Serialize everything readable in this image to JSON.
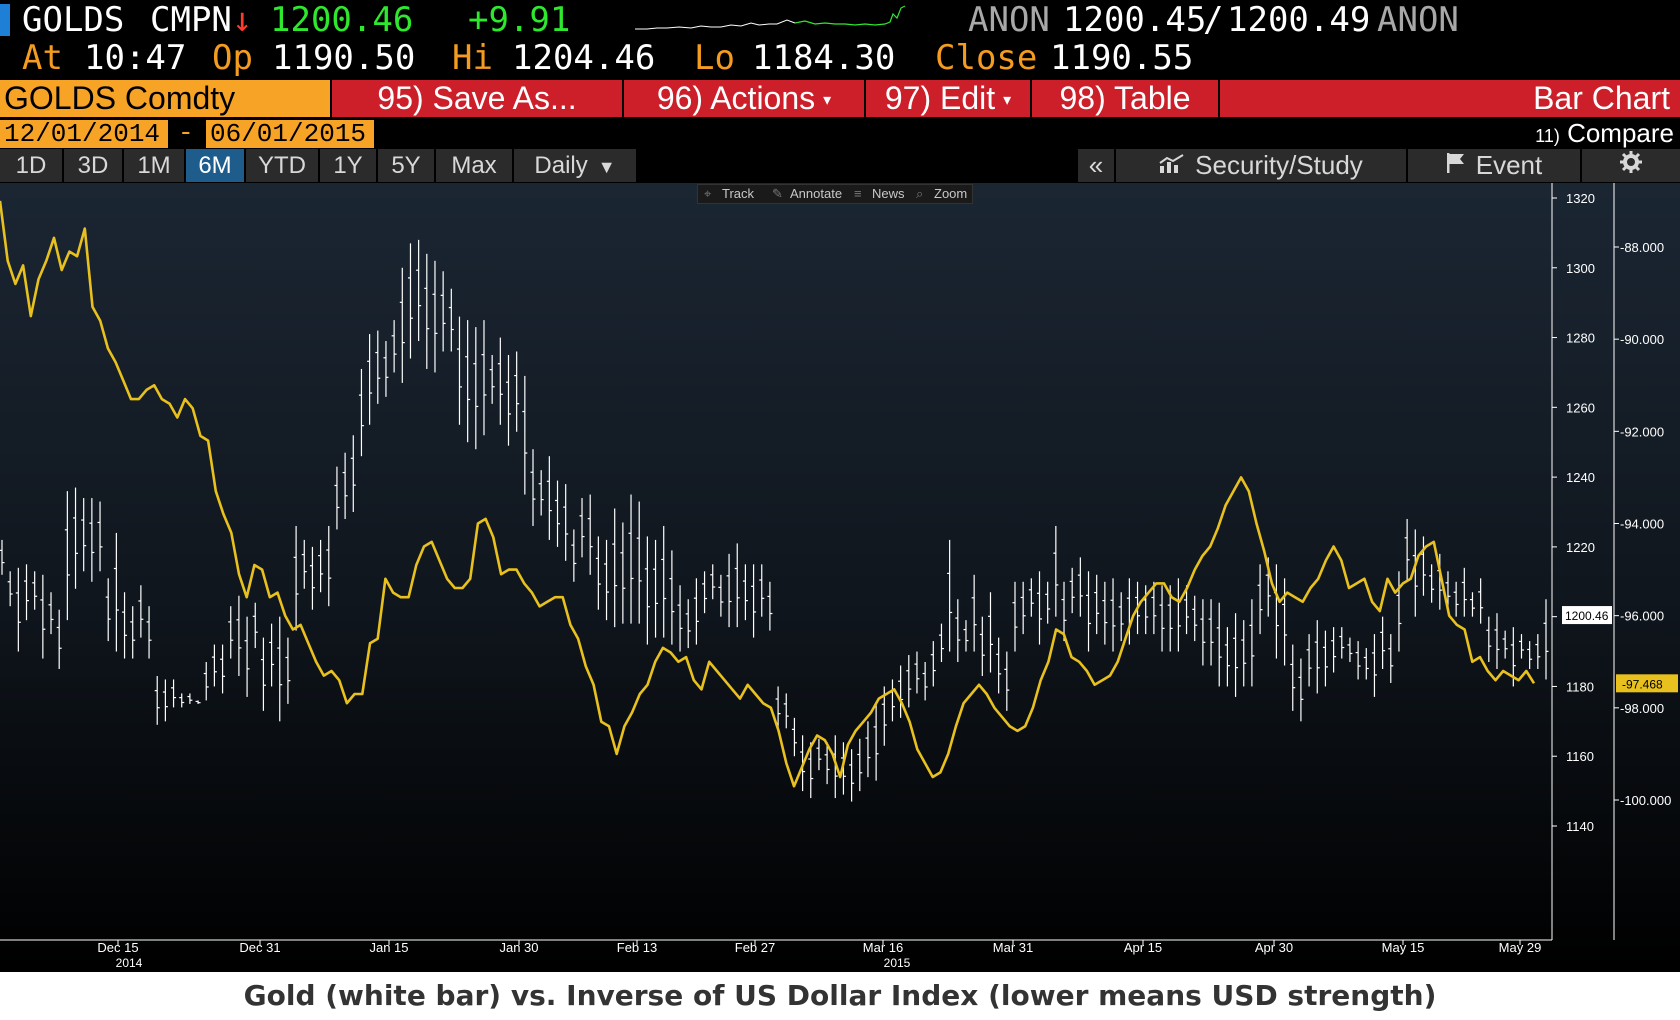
{
  "quote": {
    "ticker": "GOLDS",
    "source": "CMPN",
    "direction_arrow": "↓",
    "last": "1200.46",
    "change": "+9.91",
    "bid_src": "ANON",
    "bid": "1200.45",
    "slash": "/",
    "ask": "1200.49",
    "ask_src": "ANON",
    "at_label": "At",
    "time": "10:47",
    "op_label": "Op",
    "open": "1190.50",
    "hi_label": "Hi",
    "high": "1204.46",
    "lo_label": "Lo",
    "low": "1184.30",
    "close_label": "Close",
    "close": "1190.55"
  },
  "cmdbar": {
    "security": "GOLDS Comdty",
    "save_as": "95) Save As...",
    "actions": "96) Actions",
    "edit": "97) Edit",
    "table": "98) Table",
    "title": "Bar Chart",
    "caret": "▾"
  },
  "dates": {
    "start": "12/01/2014",
    "dash": "-",
    "end": "06/01/2015",
    "compare_num": "11)",
    "compare": "Compare"
  },
  "periods": [
    "1D",
    "3D",
    "1M",
    "6M",
    "YTD",
    "1Y",
    "5Y",
    "Max"
  ],
  "active_period": "6M",
  "frequency": "Daily",
  "frequency_caret": "▼",
  "right_tools": {
    "collapse": "«",
    "security_study": "Security/Study",
    "event": "Event",
    "settings_icon": "gear-icon"
  },
  "mini_toolbar": {
    "track": "Track",
    "annotate": "Annotate",
    "news": "News",
    "zoom": "Zoom"
  },
  "caption": "Gold (white bar) vs. Inverse of US Dollar Index (lower means USD strength)",
  "colors": {
    "orange": "#f7a326",
    "red_bar": "#cc1f2a",
    "gold_line": "#e8c11e",
    "price_green": "#2ee82e",
    "down_red": "#ff3b2f"
  },
  "chart_data": {
    "type": "line",
    "x_tick_labels": [
      "Dec 15",
      "Dec 31",
      "Jan 15",
      "Jan 30",
      "Feb 13",
      "Feb 27",
      "Mar 16",
      "Mar 31",
      "Apr 15",
      "Apr 30",
      "May 15",
      "May 29"
    ],
    "x_year_labels": [
      "2014",
      "2015"
    ],
    "left_axis": {
      "ticks": [
        1320,
        1300,
        1280,
        1260,
        1240,
        1220,
        1200,
        1180,
        1160,
        1140
      ],
      "range": [
        1133,
        1324
      ]
    },
    "right_axis": {
      "ticks": [
        "-88.000",
        "-90.000",
        "-92.000",
        "-94.000",
        "-96.000",
        "-98.000",
        "-100.000"
      ],
      "range": [
        -101.5,
        -86.0
      ]
    },
    "last_price_label": "1200.46",
    "usd_last_label": "-97.468",
    "gold_bars": [
      [
        1212,
        1222
      ],
      [
        1203,
        1213
      ],
      [
        1190,
        1214
      ],
      [
        1199,
        1215
      ],
      [
        1202,
        1213
      ],
      [
        1188,
        1212
      ],
      [
        1195,
        1207
      ],
      [
        1185,
        1202
      ],
      [
        1199,
        1236
      ],
      [
        1208,
        1237
      ],
      [
        1213,
        1234
      ],
      [
        1210,
        1234
      ],
      [
        1213,
        1233
      ],
      [
        1193,
        1211
      ],
      [
        1190,
        1224
      ],
      [
        1188,
        1207
      ],
      [
        1188,
        1203
      ],
      [
        1194,
        1209
      ],
      [
        1188,
        1203
      ],
      [
        1169,
        1183
      ],
      [
        1170,
        1182
      ],
      [
        1174,
        1182
      ],
      [
        1174,
        1178
      ],
      [
        1175,
        1178
      ],
      [
        1175,
        1176
      ],
      [
        1176,
        1187
      ],
      [
        1180,
        1192
      ],
      [
        1178,
        1192
      ],
      [
        1188,
        1203
      ],
      [
        1183,
        1206
      ],
      [
        1177,
        1200
      ],
      [
        1191,
        1204
      ],
      [
        1173,
        1194
      ],
      [
        1180,
        1198
      ],
      [
        1170,
        1200
      ],
      [
        1175,
        1194
      ],
      [
        1196,
        1226
      ],
      [
        1208,
        1222
      ],
      [
        1202,
        1220
      ],
      [
        1207,
        1222
      ],
      [
        1203,
        1226
      ],
      [
        1225,
        1243
      ],
      [
        1228,
        1247
      ],
      [
        1230,
        1252
      ],
      [
        1246,
        1271
      ],
      [
        1255,
        1281
      ],
      [
        1261,
        1282
      ],
      [
        1263,
        1279
      ],
      [
        1270,
        1285
      ],
      [
        1267,
        1300
      ],
      [
        1274,
        1307
      ],
      [
        1279,
        1308
      ],
      [
        1271,
        1304
      ],
      [
        1270,
        1302
      ],
      [
        1276,
        1299
      ],
      [
        1276,
        1294
      ],
      [
        1255,
        1286
      ],
      [
        1250,
        1285
      ],
      [
        1248,
        1283
      ],
      [
        1252,
        1285
      ],
      [
        1261,
        1275
      ],
      [
        1255,
        1280
      ],
      [
        1249,
        1275
      ],
      [
        1253,
        1276
      ],
      [
        1235,
        1269
      ],
      [
        1226,
        1248
      ],
      [
        1229,
        1242
      ],
      [
        1222,
        1246
      ],
      [
        1220,
        1239
      ],
      [
        1216,
        1238
      ],
      [
        1210,
        1225
      ],
      [
        1217,
        1234
      ],
      [
        1212,
        1235
      ],
      [
        1202,
        1223
      ],
      [
        1199,
        1222
      ],
      [
        1197,
        1231
      ],
      [
        1198,
        1227
      ],
      [
        1198,
        1235
      ],
      [
        1198,
        1233
      ],
      [
        1192,
        1223
      ],
      [
        1194,
        1222
      ],
      [
        1194,
        1226
      ],
      [
        1192,
        1219
      ],
      [
        1190,
        1209
      ],
      [
        1191,
        1205
      ],
      [
        1192,
        1211
      ],
      [
        1201,
        1213
      ],
      [
        1205,
        1215
      ],
      [
        1200,
        1212
      ],
      [
        1197,
        1218
      ],
      [
        1197,
        1221
      ],
      [
        1199,
        1215
      ],
      [
        1194,
        1215
      ],
      [
        1200,
        1215
      ],
      [
        1196,
        1210
      ],
      [
        1168,
        1180
      ],
      [
        1168,
        1178
      ],
      [
        1160,
        1171
      ],
      [
        1150,
        1166
      ],
      [
        1148,
        1164
      ],
      [
        1156,
        1165
      ],
      [
        1152,
        1164
      ],
      [
        1148,
        1166
      ],
      [
        1149,
        1164
      ],
      [
        1147,
        1162
      ],
      [
        1150,
        1165
      ],
      [
        1154,
        1170
      ],
      [
        1153,
        1175
      ],
      [
        1163,
        1180
      ],
      [
        1170,
        1182
      ],
      [
        1171,
        1186
      ],
      [
        1174,
        1189
      ],
      [
        1178,
        1190
      ],
      [
        1176,
        1187
      ],
      [
        1180,
        1193
      ],
      [
        1187,
        1198
      ],
      [
        1190,
        1222
      ],
      [
        1187,
        1205
      ],
      [
        1190,
        1199
      ],
      [
        1190,
        1212
      ],
      [
        1183,
        1200
      ],
      [
        1184,
        1207
      ],
      [
        1178,
        1194
      ],
      [
        1173,
        1190
      ],
      [
        1190,
        1210
      ],
      [
        1195,
        1210
      ],
      [
        1200,
        1211
      ],
      [
        1192,
        1213
      ],
      [
        1198,
        1210
      ],
      [
        1200,
        1226
      ],
      [
        1193,
        1210
      ],
      [
        1201,
        1214
      ],
      [
        1200,
        1217
      ],
      [
        1190,
        1213
      ],
      [
        1195,
        1212
      ],
      [
        1192,
        1210
      ],
      [
        1190,
        1211
      ],
      [
        1193,
        1207
      ],
      [
        1192,
        1211
      ],
      [
        1195,
        1210
      ],
      [
        1195,
        1209
      ],
      [
        1195,
        1210
      ],
      [
        1190,
        1209
      ],
      [
        1190,
        1209
      ],
      [
        1190,
        1211
      ],
      [
        1195,
        1209
      ],
      [
        1193,
        1206
      ],
      [
        1186,
        1205
      ],
      [
        1186,
        1205
      ],
      [
        1180,
        1204
      ],
      [
        1180,
        1197
      ],
      [
        1177,
        1201
      ],
      [
        1180,
        1199
      ],
      [
        1180,
        1205
      ],
      [
        1195,
        1215
      ],
      [
        1200,
        1217
      ],
      [
        1188,
        1215
      ],
      [
        1186,
        1211
      ],
      [
        1173,
        1192
      ],
      [
        1170,
        1188
      ],
      [
        1180,
        1195
      ],
      [
        1178,
        1199
      ],
      [
        1180,
        1196
      ],
      [
        1184,
        1197
      ],
      [
        1188,
        1197
      ],
      [
        1187,
        1194
      ],
      [
        1182,
        1193
      ],
      [
        1182,
        1191
      ],
      [
        1177,
        1195
      ],
      [
        1185,
        1200
      ],
      [
        1181,
        1195
      ],
      [
        1190,
        1213
      ],
      [
        1210,
        1228
      ],
      [
        1200,
        1225
      ],
      [
        1206,
        1223
      ],
      [
        1204,
        1215
      ],
      [
        1202,
        1218
      ],
      [
        1202,
        1213
      ],
      [
        1200,
        1210
      ],
      [
        1200,
        1214
      ],
      [
        1200,
        1207
      ],
      [
        1198,
        1211
      ],
      [
        1187,
        1200
      ],
      [
        1185,
        1201
      ],
      [
        1188,
        1196
      ],
      [
        1180,
        1197
      ],
      [
        1188,
        1195
      ],
      [
        1185,
        1193
      ],
      [
        1185,
        1195
      ],
      [
        1182,
        1205
      ]
    ],
    "usd_inverse": [
      -87.0,
      -88.3,
      -88.8,
      -88.4,
      -89.5,
      -88.7,
      -88.3,
      -87.8,
      -88.5,
      -88.1,
      -88.2,
      -87.6,
      -89.3,
      -89.6,
      -90.2,
      -90.5,
      -90.9,
      -91.3,
      -91.3,
      -91.1,
      -91.0,
      -91.3,
      -91.4,
      -91.7,
      -91.3,
      -91.5,
      -92.1,
      -92.2,
      -93.3,
      -93.8,
      -94.2,
      -95.1,
      -95.6,
      -94.9,
      -95.0,
      -95.6,
      -95.5,
      -96.0,
      -96.3,
      -96.2,
      -96.6,
      -97.0,
      -97.3,
      -97.2,
      -97.4,
      -97.9,
      -97.7,
      -97.7,
      -96.6,
      -96.5,
      -95.2,
      -95.5,
      -95.6,
      -95.6,
      -94.9,
      -94.5,
      -94.4,
      -94.8,
      -95.2,
      -95.4,
      -95.4,
      -95.2,
      -94.0,
      -93.9,
      -94.3,
      -95.1,
      -95.0,
      -95.0,
      -95.3,
      -95.5,
      -95.8,
      -95.7,
      -95.6,
      -95.6,
      -96.2,
      -96.5,
      -97.1,
      -97.5,
      -98.3,
      -98.4,
      -99.0,
      -98.4,
      -98.1,
      -97.7,
      -97.5,
      -97.0,
      -96.7,
      -96.8,
      -97.0,
      -96.9,
      -97.4,
      -97.6,
      -97.0,
      -97.2,
      -97.4,
      -97.6,
      -97.8,
      -97.5,
      -97.7,
      -97.9,
      -98.0,
      -98.5,
      -99.2,
      -99.7,
      -99.3,
      -98.9,
      -98.6,
      -98.7,
      -99.0,
      -99.5,
      -98.8,
      -98.5,
      -98.3,
      -98.1,
      -97.8,
      -97.7,
      -97.6,
      -97.9,
      -98.3,
      -98.9,
      -99.2,
      -99.5,
      -99.4,
      -99.0,
      -98.4,
      -97.9,
      -97.7,
      -97.5,
      -97.7,
      -98.0,
      -98.2,
      -98.4,
      -98.5,
      -98.4,
      -98.0,
      -97.4,
      -97.0,
      -96.3,
      -96.4,
      -96.9,
      -97.0,
      -97.2,
      -97.5,
      -97.4,
      -97.3,
      -97.0,
      -96.5,
      -96.0,
      -95.7,
      -95.5,
      -95.3,
      -95.3,
      -95.6,
      -95.7,
      -95.4,
      -95.0,
      -94.7,
      -94.5,
      -94.1,
      -93.6,
      -93.3,
      -93.0,
      -93.3,
      -94.0,
      -94.6,
      -95.3,
      -95.7,
      -95.5,
      -95.6,
      -95.7,
      -95.4,
      -95.2,
      -94.8,
      -94.5,
      -94.8,
      -95.4,
      -95.3,
      -95.2,
      -95.7,
      -95.9,
      -95.2,
      -95.5,
      -95.3,
      -95.2,
      -94.7,
      -94.5,
      -94.4,
      -95.2,
      -96.0,
      -96.2,
      -96.3,
      -97.0,
      -96.9,
      -97.2,
      -97.4,
      -97.2,
      -97.3,
      -97.4,
      -97.2,
      -97.468
    ]
  }
}
